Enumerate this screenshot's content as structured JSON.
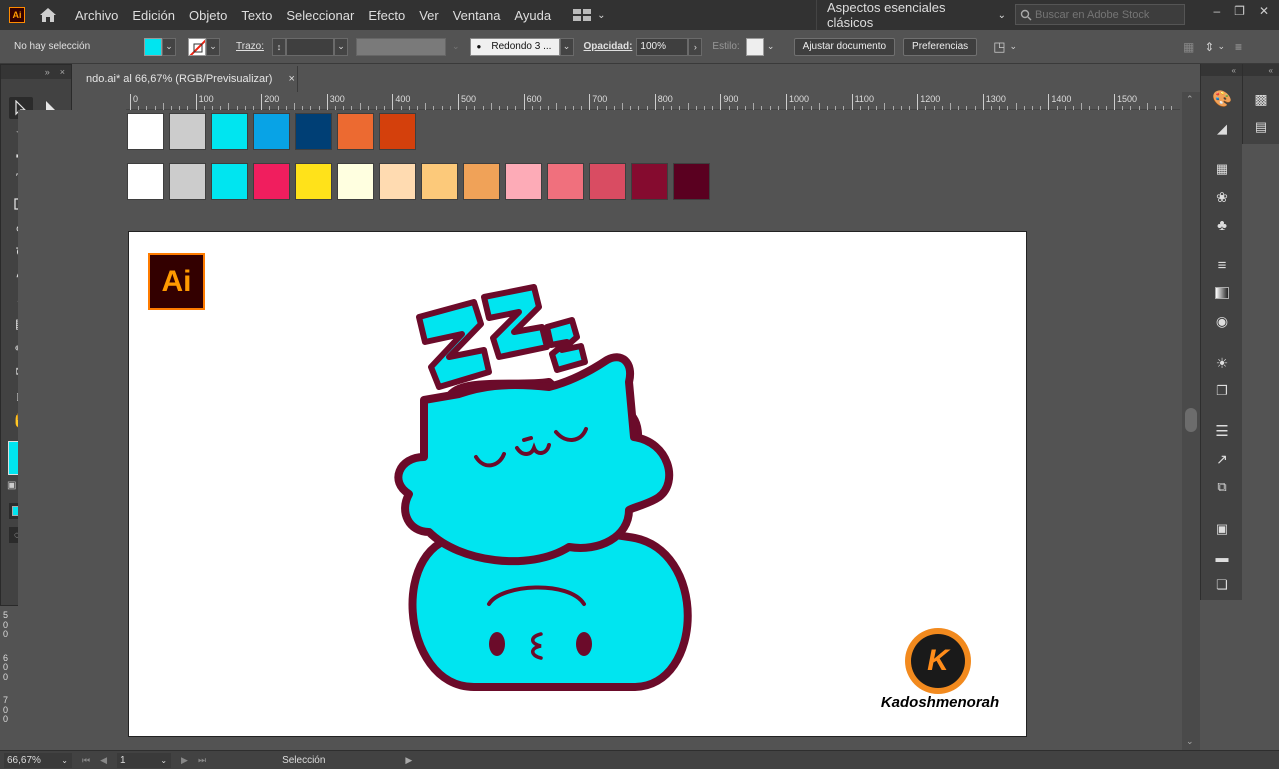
{
  "menu": {
    "logo": "Ai",
    "items": [
      "Archivo",
      "Edición",
      "Objeto",
      "Texto",
      "Seleccionar",
      "Efecto",
      "Ver",
      "Ventana",
      "Ayuda"
    ],
    "workspace": "Aspectos esenciales clásicos",
    "search_placeholder": "Buscar en Adobe Stock"
  },
  "control": {
    "selection": "No hay selección",
    "stroke_label": "Trazo:",
    "brush": "Redondo 3 ...",
    "opacity_label": "Opacidad:",
    "opacity_value": "100%",
    "style_label": "Estilo:",
    "fit_button": "Ajustar documento",
    "prefs_button": "Preferencias"
  },
  "document": {
    "tab_title": "ndo.ai* al 66,67% (RGB/Previsualizar)",
    "close": "×"
  },
  "ruler": {
    "ticks": [
      "0",
      "100",
      "200",
      "300",
      "400",
      "500",
      "600",
      "700",
      "800",
      "900",
      "1000",
      "1100",
      "1200",
      "1300",
      "1400",
      "1500"
    ]
  },
  "vruler": {
    "ticks": [
      "5",
      "0",
      "0",
      "6",
      "0",
      "0",
      "7",
      "0",
      "0"
    ]
  },
  "swatches": {
    "row1": [
      "#ffffff",
      "#cccccc",
      "#00e5f0",
      "#08a3e6",
      "#003f75",
      "#ec6a31",
      "#d4400c"
    ],
    "row2": [
      "#ffffff",
      "#cccccc",
      "#00e5f0",
      "#f01e5e",
      "#ffe21a",
      "#ffffe0",
      "#ffdbb1",
      "#fcc97a",
      "#f0a258",
      "#fdabb7",
      "#f0707d",
      "#d94c62",
      "#850b2f",
      "#5a0020"
    ]
  },
  "colors": {
    "fill": "#00e5f0",
    "cat_fill": "#00e5f0",
    "cat_stroke": "#6b0b2a",
    "ui_bg": "#535353",
    "accent": "#ff8c00"
  },
  "artboard": {
    "ai_label": "Ai",
    "logo_letter": "K",
    "watermark": "Kadoshmenorah"
  },
  "status": {
    "zoom": "66,67%",
    "page": "1",
    "tool": "Selección"
  }
}
